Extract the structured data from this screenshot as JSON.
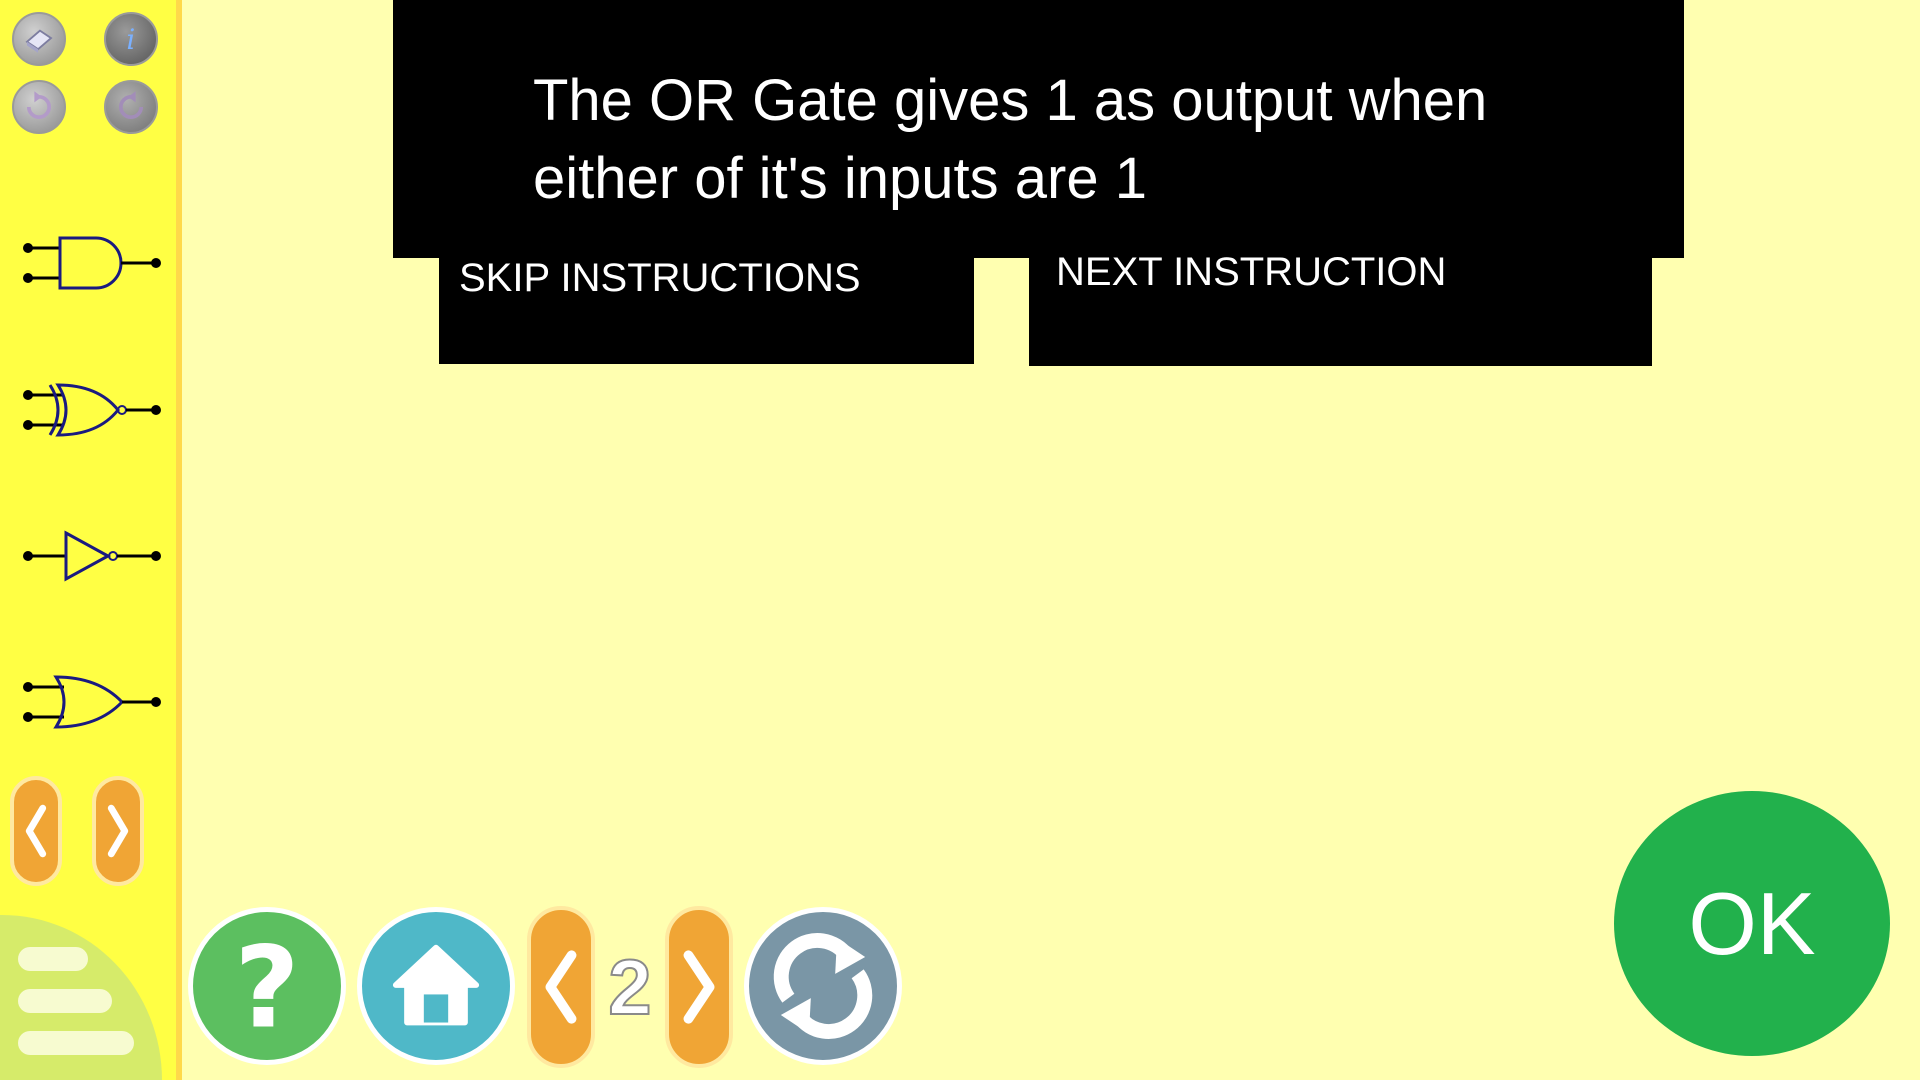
{
  "sidebar": {
    "top_buttons": [
      "eraser-icon",
      "info-icon",
      "undo-icon",
      "redo-icon"
    ],
    "tools": [
      "and-gate",
      "xor-gate",
      "not-gate",
      "or-gate"
    ]
  },
  "instruction": {
    "text": "The OR Gate gives 1 as output when either of it's inputs are 1",
    "skip_label": "SKIP INSTRUCTIONS",
    "next_label": "NEXT INSTRUCTION"
  },
  "bottom_bar": {
    "level": "2"
  },
  "ok_label": "OK",
  "colors": {
    "background": "#ffffb0",
    "sidebar": "#ffff44",
    "orange": "#f0a535",
    "ok_green": "#22b14c",
    "help_green": "#5cbf60",
    "home_blue": "#4fb8c8",
    "reload_gray": "#7a96a6"
  }
}
